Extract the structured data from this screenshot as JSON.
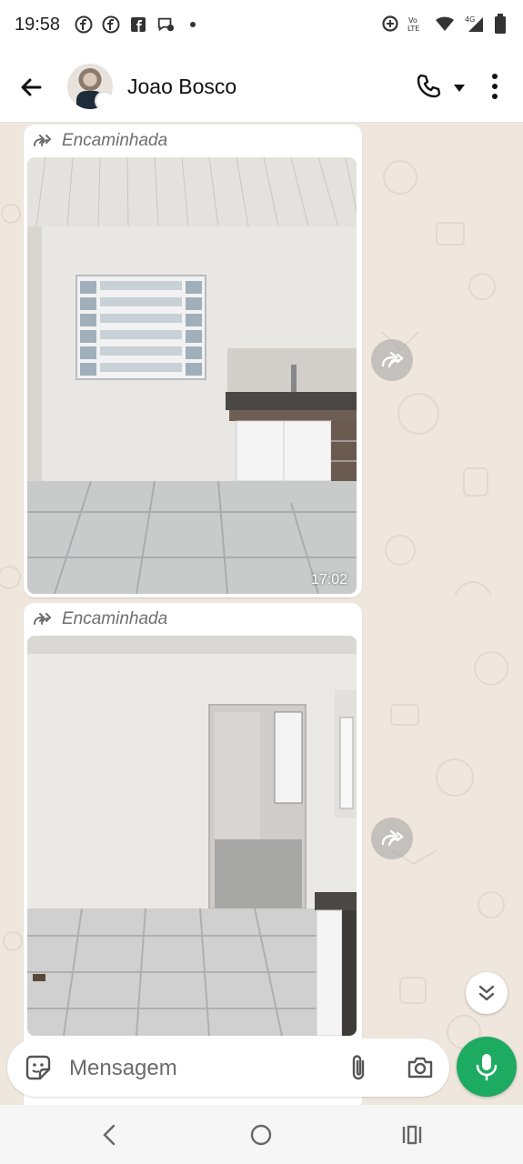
{
  "status_bar": {
    "time": "19:58",
    "left_icons": [
      "facebook-icon",
      "facebook-icon",
      "facebook-square-icon",
      "messenger-icon",
      "dot-icon"
    ],
    "right_icons": [
      "data-saver-icon",
      "volte-icon",
      "wifi-icon",
      "signal-4g-icon",
      "battery-icon"
    ],
    "network": "4G",
    "volte": "Vo LTE"
  },
  "header": {
    "contact_name": "Joao Bosco",
    "icons": [
      "back-arrow-icon",
      "avatar",
      "phone-icon",
      "caret-down-icon",
      "more-vert-icon"
    ]
  },
  "messages": [
    {
      "forwarded_label": "Encaminhada",
      "timestamp": "17:02",
      "image_description": "kitchen-room-photo"
    },
    {
      "forwarded_label": "Encaminhada",
      "image_description": "room-with-doorway-photo"
    }
  ],
  "composer": {
    "placeholder": "Mensagem"
  },
  "colors": {
    "accent_green": "#1daa61",
    "chat_background": "#efe7dd",
    "bubble": "#ffffff"
  }
}
